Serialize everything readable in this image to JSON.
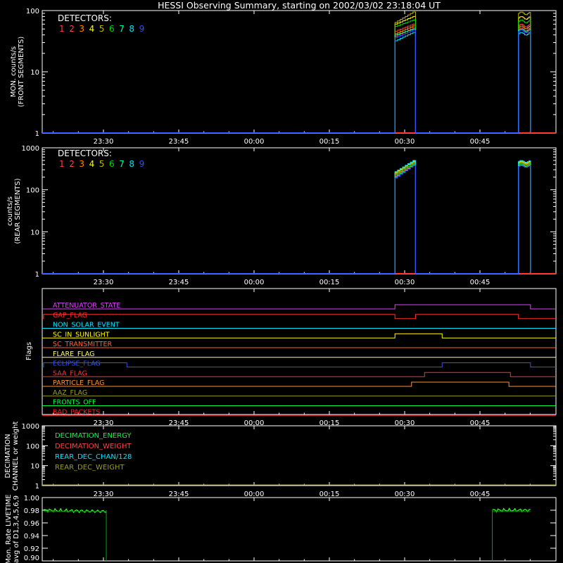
{
  "title": "HESSI Observing Summary, starting on 2002/03/02 23:18:04 UT",
  "time_ticks": [
    "23:30",
    "23:45",
    "00:00",
    "00:15",
    "00:30",
    "00:45"
  ],
  "detectors": {
    "label": "DETECTORS:",
    "numbers": [
      "1",
      "2",
      "3",
      "4",
      "5",
      "6",
      "7",
      "8",
      "9"
    ],
    "colors": [
      "#ff4040",
      "#ff4040",
      "#ff8c00",
      "#ffff00",
      "#b8b800",
      "#00dd00",
      "#00ff99",
      "#00e0ff",
      "#3050ff"
    ]
  },
  "panel1": {
    "ylabel_line1": "MON. counts/s",
    "ylabel_line2": "(FRONT SEGMENTS)",
    "ytick_labels": [
      "100",
      "10",
      "1"
    ]
  },
  "panel2": {
    "ylabel_line1": "counts/s",
    "ylabel_line2": "(REAR SEGMENTS)",
    "ytick_labels": [
      "1000",
      "100",
      "10",
      "1"
    ]
  },
  "panel3": {
    "ylabel": "Flags",
    "flags": [
      {
        "label": "ATTENUATOR_STATE",
        "color": "#e040ff"
      },
      {
        "label": "GAP_FLAG",
        "color": "#ff3030"
      },
      {
        "label": "NON_SOLAR_EVENT",
        "color": "#00e5ff"
      },
      {
        "label": "SC_IN_SUNLIGHT",
        "color": "#ffff00"
      },
      {
        "label": "SC_TRANSMITTER",
        "color": "#ff6030"
      },
      {
        "label": "FLARE_FLAG",
        "color": "#ffff60"
      },
      {
        "label": "ECLIPSE_FLAG",
        "color": "#3050ff"
      },
      {
        "label": "SAA_FLAG",
        "color": "#ff3030"
      },
      {
        "label": "PARTICLE_FLAG",
        "color": "#ff9030"
      },
      {
        "label": "AAZ_FLAG",
        "color": "#9a9a30"
      },
      {
        "label": "FRONTS_OFF",
        "color": "#00ff40"
      },
      {
        "label": "BAD_PACKETS",
        "color": "#ff2020"
      }
    ]
  },
  "panel4": {
    "ylabel_line1": "DECIMATION",
    "ylabel_line2": "CHANNEL or weight",
    "ytick_labels": [
      "1000",
      "100",
      "10",
      "1"
    ],
    "legend": [
      {
        "label": "DECIMATION_ENERGY",
        "color": "#00ff40"
      },
      {
        "label": "DECIMATION_WEIGHT",
        "color": "#ff4040"
      },
      {
        "label": "REAR_DEC_CHAN/128",
        "color": "#00e5ff"
      },
      {
        "label": "REAR_DEC_WEIGHT",
        "color": "#9a9a30"
      }
    ]
  },
  "panel5": {
    "ylabel_line1": "Mon. Rate LIVETIME",
    "ylabel_line2": "avg of D1,3,4,5,6,9",
    "ytick_labels": [
      "1.00",
      "0.98",
      "0.96",
      "0.94",
      "0.92",
      "0.90"
    ]
  },
  "chart_data": [
    {
      "type": "line",
      "panel": "front",
      "yscale": "log",
      "ylim": [
        1,
        100
      ],
      "x_unit": "minutes after 23:18:04 UT",
      "xlim": [
        0,
        97
      ],
      "segments": [
        {
          "start": 70.0,
          "end": 74.1
        },
        {
          "start": 94.6,
          "end": 97
        }
      ],
      "series": [
        {
          "name": "1",
          "start": 46,
          "end": 60
        },
        {
          "name": "2",
          "start": 38,
          "end": 52
        },
        {
          "name": "3",
          "start": 42,
          "end": 56
        },
        {
          "name": "4",
          "start": 60,
          "end": 80
        },
        {
          "name": "5",
          "start": 64,
          "end": 95
        },
        {
          "name": "6",
          "start": 55,
          "end": 70
        },
        {
          "name": "7",
          "start": 40,
          "end": 50
        },
        {
          "name": "8",
          "start": 32,
          "end": 44
        },
        {
          "name": "9",
          "start": 36,
          "end": 48
        }
      ]
    },
    {
      "type": "line",
      "panel": "rear",
      "yscale": "log",
      "ylim": [
        1,
        1000
      ],
      "segments": [
        {
          "start": 70.0,
          "end": 74.1
        },
        {
          "start": 94.6,
          "end": 97
        }
      ],
      "series": [
        {
          "name": "1",
          "start": 210,
          "end": 400
        },
        {
          "name": "2",
          "start": 220,
          "end": 420
        },
        {
          "name": "3",
          "start": 240,
          "end": 460
        },
        {
          "name": "4",
          "start": 260,
          "end": 480
        },
        {
          "name": "5",
          "start": 250,
          "end": 450
        },
        {
          "name": "6",
          "start": 230,
          "end": 430
        },
        {
          "name": "7",
          "start": 200,
          "end": 390
        },
        {
          "name": "8",
          "start": 270,
          "end": 500
        },
        {
          "name": "9",
          "start": 190,
          "end": 380
        }
      ]
    },
    {
      "type": "line",
      "panel": "flags",
      "x_unit": "minutes after 23:18:04 UT",
      "flags": [
        {
          "name": "ATTENUATOR_STATE",
          "high": [
            [
              70.0,
              97
            ]
          ]
        },
        {
          "name": "GAP_FLAG",
          "high": [
            [
              0,
              70.0
            ],
            [
              74.1,
              94.6
            ]
          ]
        },
        {
          "name": "NON_SOLAR_EVENT",
          "high": []
        },
        {
          "name": "SC_IN_SUNLIGHT",
          "high": [
            [
              70.0,
              79.4
            ]
          ]
        },
        {
          "name": "SC_TRANSMITTER",
          "high": []
        },
        {
          "name": "FLARE_FLAG",
          "high": []
        },
        {
          "name": "ECLIPSE_FLAG",
          "high": [
            [
              0,
              16.6
            ],
            [
              79.4,
              97
            ]
          ]
        },
        {
          "name": "SAA_FLAG",
          "high": [
            [
              75.9,
              93.0
            ]
          ]
        },
        {
          "name": "PARTICLE_FLAG",
          "high": [
            [
              73.3,
              92.7
            ]
          ]
        },
        {
          "name": "AAZ_FLAG",
          "high": []
        },
        {
          "name": "FRONTS_OFF",
          "high": []
        },
        {
          "name": "BAD_PACKETS",
          "high": []
        }
      ]
    },
    {
      "type": "line",
      "panel": "decimation",
      "yscale": "log",
      "ylim": [
        1,
        1000
      ],
      "series": [
        {
          "name": "REAR_DEC_WEIGHT",
          "value": 1
        }
      ]
    },
    {
      "type": "line",
      "panel": "livetime",
      "ylim": [
        0.9,
        1.0
      ],
      "segments": [
        {
          "start": 0,
          "end": 12.5,
          "value": 0.98
        },
        {
          "start": 89.4,
          "end": 97,
          "value": 0.98
        }
      ]
    }
  ]
}
